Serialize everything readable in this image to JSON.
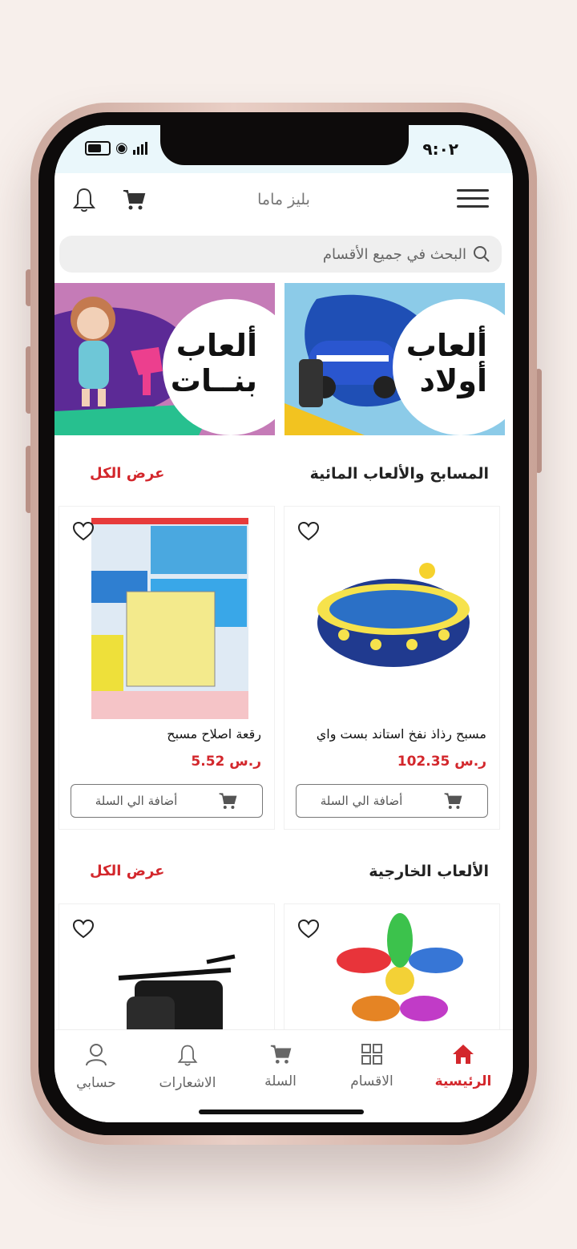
{
  "status": {
    "time": "٩:٠٢"
  },
  "header": {
    "title": "بليز ماما"
  },
  "search": {
    "placeholder": "البحث في جميع الأقسام"
  },
  "banners": [
    {
      "label_line1": "ألعاب",
      "label_line2": "أولاد",
      "color": "#8ccbe8"
    },
    {
      "label_line1": "ألعاب",
      "label_line2": "بنــات",
      "color": "#c57bb7"
    }
  ],
  "sections": [
    {
      "title": "المسابح والألعاب المائية",
      "view_all": "عرض الكل",
      "products": [
        {
          "name": "مسبح رذاذ نفخ استاند بست واي",
          "price": "102.35 ر.س",
          "add_label": "أضافة الي السلة"
        },
        {
          "name": "رقعة اصلاح مسبح",
          "price": "5.52 ر.س",
          "add_label": "أضافة الي السلة"
        }
      ]
    },
    {
      "title": "الألعاب الخارجية",
      "view_all": "عرض الكل"
    }
  ],
  "bottom_nav": [
    {
      "label": "الرئيسية",
      "icon": "home-icon",
      "active": true
    },
    {
      "label": "الاقسام",
      "icon": "grid-icon",
      "active": false
    },
    {
      "label": "السلة",
      "icon": "cart-icon",
      "active": false
    },
    {
      "label": "الاشعارات",
      "icon": "bell-icon",
      "active": false
    },
    {
      "label": "حسابي",
      "icon": "user-icon",
      "active": false
    }
  ],
  "colors": {
    "accent": "#d3272c",
    "background": "#f7efeb"
  }
}
